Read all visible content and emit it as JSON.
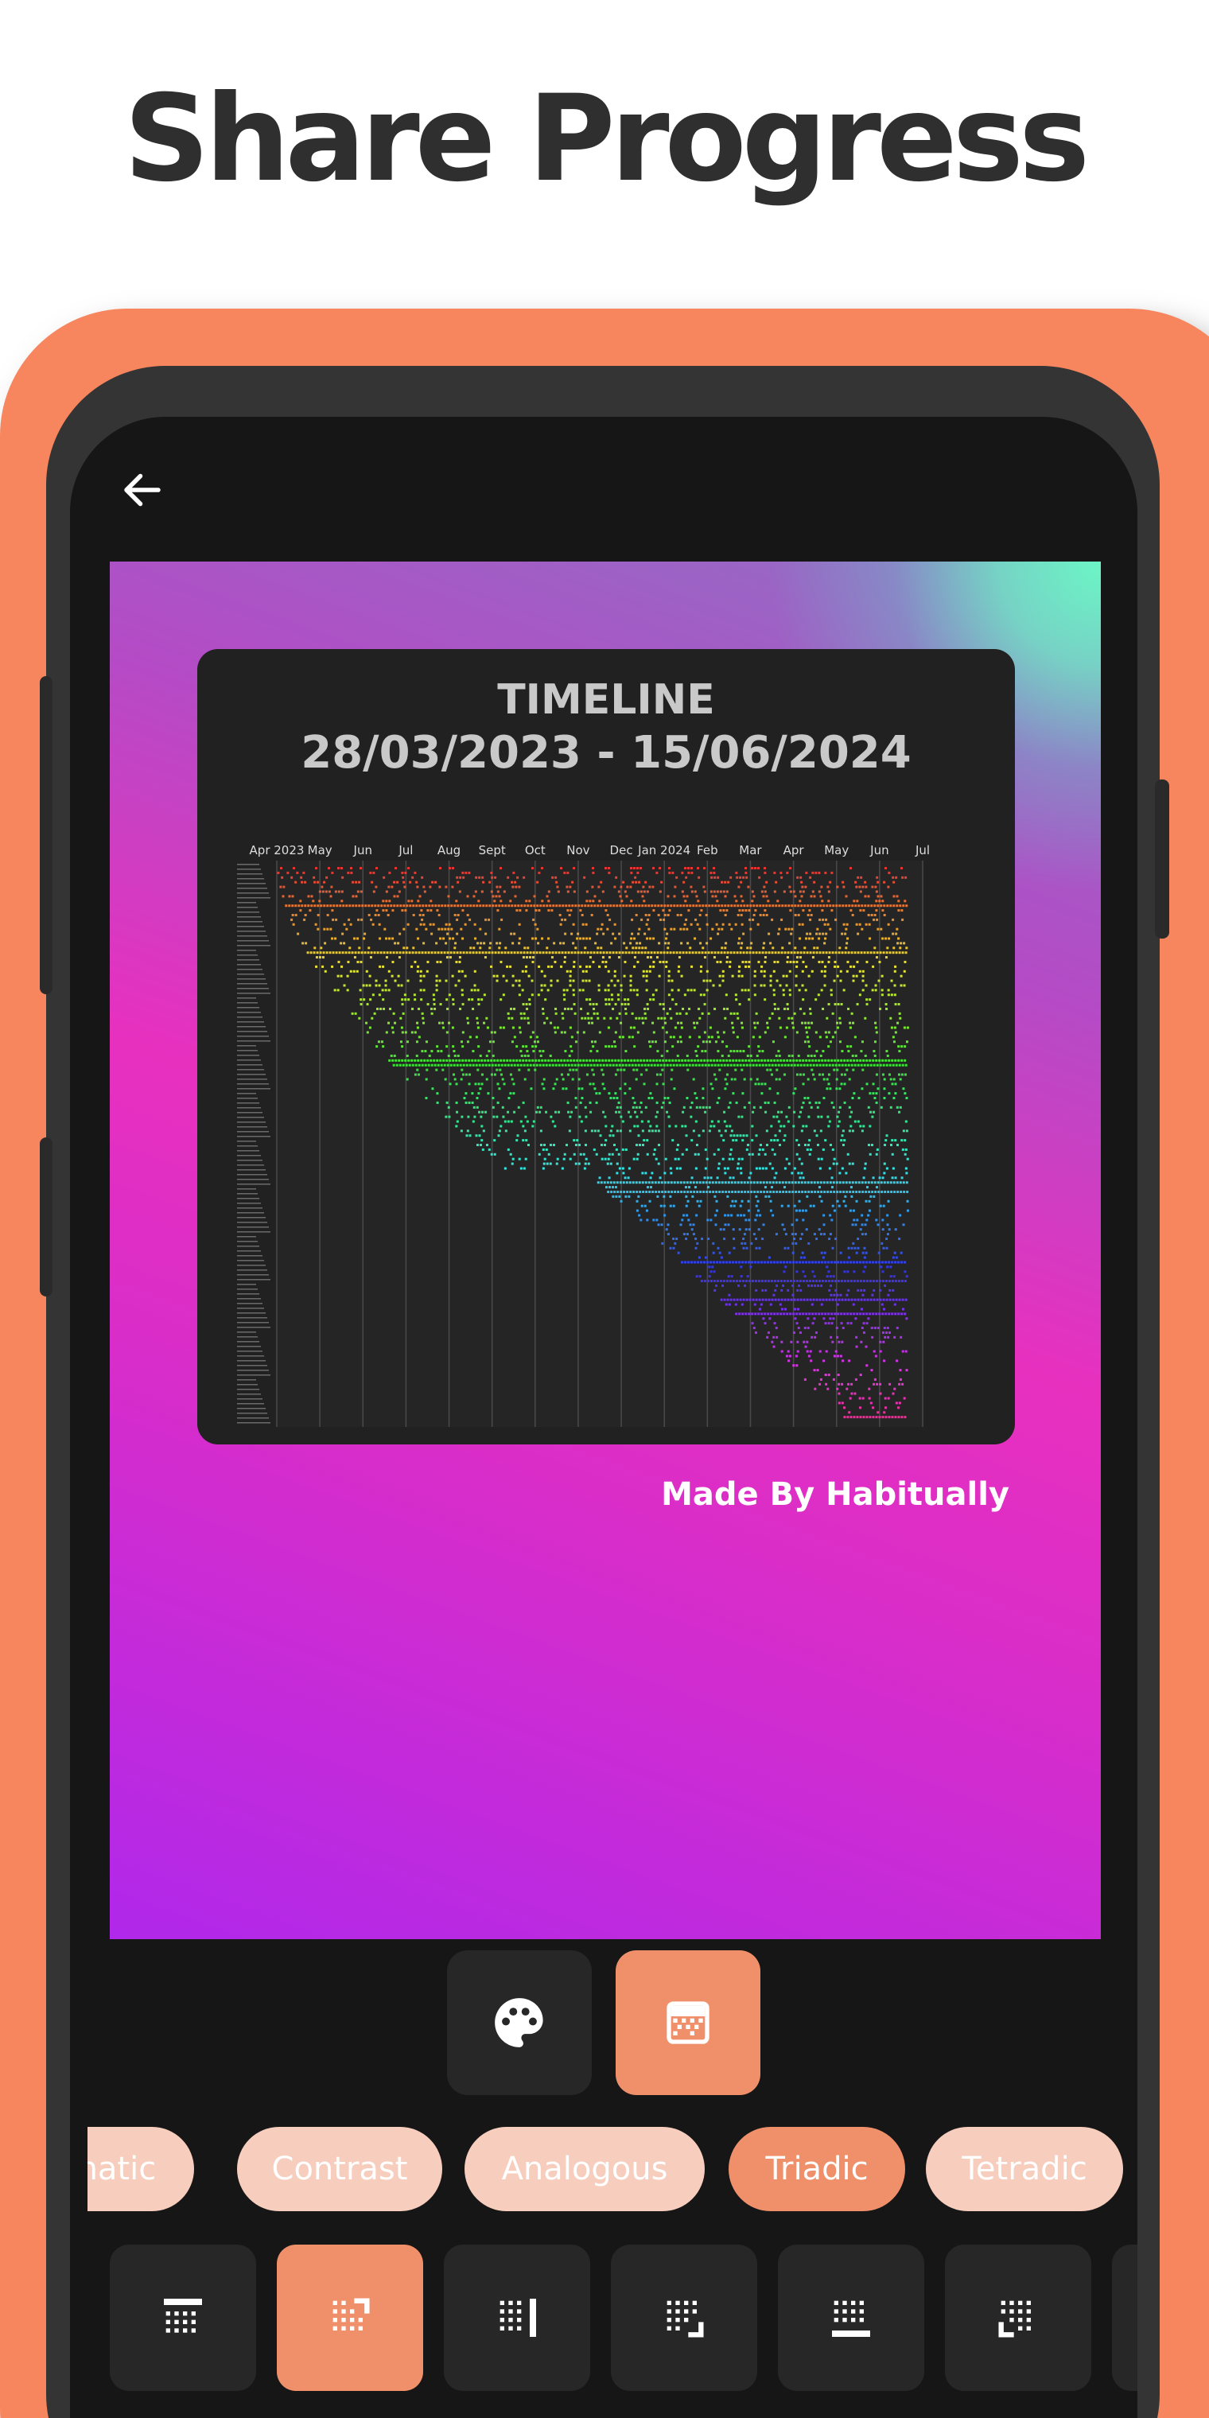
{
  "headline": "Share Progress",
  "colors": {
    "accent": "#f0906a",
    "frame": "#f7865f",
    "screen_bg": "#161616",
    "card_bg": "#212121",
    "chip_inactive": "#f7cdbd"
  },
  "top_bar": {
    "back_icon": "arrow-left-icon"
  },
  "share_card": {
    "title": "TIMELINE",
    "date_range": "28/03/2023 - 15/06/2024",
    "watermark": "Made By Habitually"
  },
  "chart_data": {
    "type": "scatter",
    "x_tick_labels": [
      "Apr 2023",
      "May",
      "Jun",
      "Jul",
      "Aug",
      "Sept",
      "Oct",
      "Nov",
      "Dec",
      "Jan 2024",
      "Feb",
      "Mar",
      "Apr",
      "May",
      "Jun",
      "Jul"
    ],
    "grid": true
  },
  "mode_buttons": [
    {
      "icon": "palette-icon",
      "active": false
    },
    {
      "icon": "gradient-pattern-icon",
      "active": true
    }
  ],
  "palette_chips": [
    {
      "label": "Monochromatic",
      "active": false
    },
    {
      "label": "Contrast",
      "active": false
    },
    {
      "label": "Analogous",
      "active": false
    },
    {
      "label": "Triadic",
      "active": true
    },
    {
      "label": "Tetradic",
      "active": false
    }
  ],
  "layout_options": [
    {
      "icon": "layout-top-border-icon",
      "active": false
    },
    {
      "icon": "layout-corner-top-right-icon",
      "active": true
    },
    {
      "icon": "layout-right-border-icon",
      "active": false
    },
    {
      "icon": "layout-corner-bottom-right-icon",
      "active": false
    },
    {
      "icon": "layout-bottom-border-icon",
      "active": false
    },
    {
      "icon": "layout-corner-bottom-left-icon",
      "active": false
    }
  ]
}
